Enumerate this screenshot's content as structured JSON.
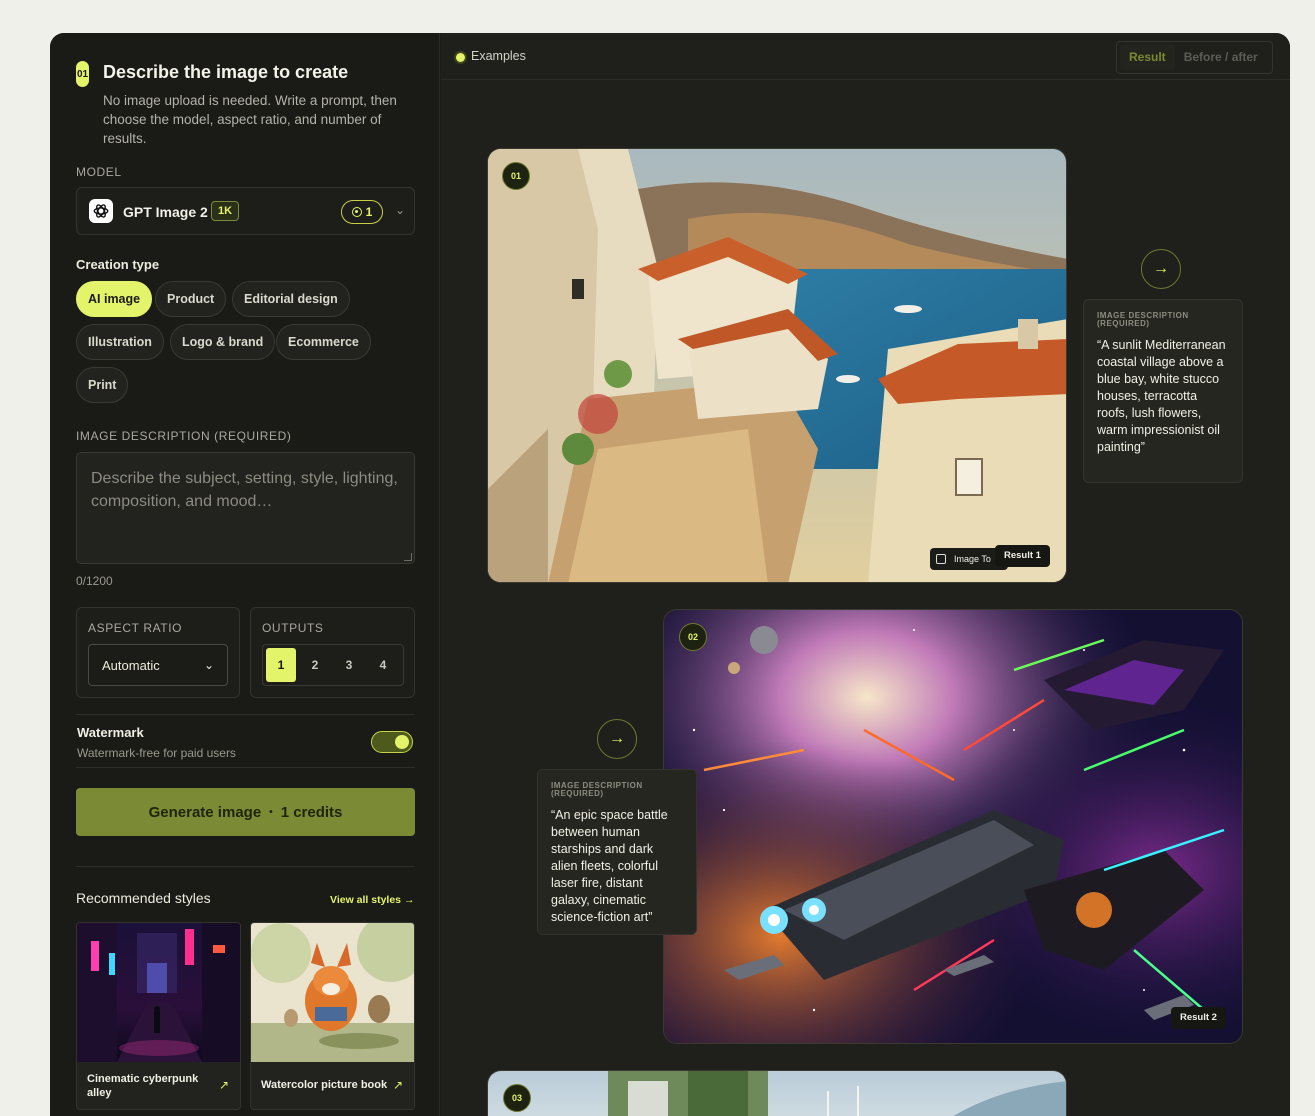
{
  "left": {
    "step_number": "01",
    "title": "Describe the image to create",
    "subtitle": "No image upload is needed. Write a prompt, then choose the model, aspect ratio, and number of results.",
    "model_label": "MODEL",
    "model_name": "GPT Image 2",
    "model_tag": "1K",
    "model_credits": "1",
    "creation_type_label": "Creation type",
    "creation_types": [
      "AI image",
      "Product",
      "Editorial design",
      "Illustration",
      "Logo & brand",
      "Ecommerce",
      "Print"
    ],
    "selected_creation_type": "AI image",
    "description_label": "IMAGE DESCRIPTION (REQUIRED)",
    "description_placeholder": "Describe the subject, setting, style, lighting, composition, and mood…",
    "char_count": "0/1200",
    "aspect_ratio_label": "ASPECT RATIO",
    "aspect_ratio_value": "Automatic",
    "outputs_label": "OUTPUTS",
    "outputs_options": [
      "1",
      "2",
      "3",
      "4"
    ],
    "outputs_selected": "1",
    "watermark_title": "Watermark",
    "watermark_sub": "Watermark-free for paid users",
    "watermark_on": true,
    "generate_label": "Generate image",
    "generate_sep": "•",
    "generate_credits": "1 credits",
    "recommended_title": "Recommended styles",
    "view_all": "View all styles",
    "styles": [
      {
        "label": "Cinematic cyberpunk alley"
      },
      {
        "label": "Watercolor picture book"
      }
    ]
  },
  "right": {
    "header_label": "Examples",
    "seg_result": "Result",
    "seg_before_after": "Before / after",
    "examples": [
      {
        "num": "01",
        "badge_small": "Image To",
        "result": "Result 1",
        "prompt_label": "IMAGE DESCRIPTION (REQUIRED)",
        "prompt": "“A sunlit Mediterranean coastal village above a blue bay, white stucco houses, terracotta roofs, lush flowers, warm impressionist oil painting”"
      },
      {
        "num": "02",
        "result": "Result 2",
        "prompt_label": "IMAGE DESCRIPTION (REQUIRED)",
        "prompt": "“An epic space battle between human starships and dark alien fleets, colorful laser fire, distant galaxy, cinematic science-fiction art”"
      },
      {
        "num": "03"
      }
    ]
  },
  "colors": {
    "accent": "#e4f46a",
    "panel": "#1c1c19",
    "button": "#7b8a34"
  }
}
